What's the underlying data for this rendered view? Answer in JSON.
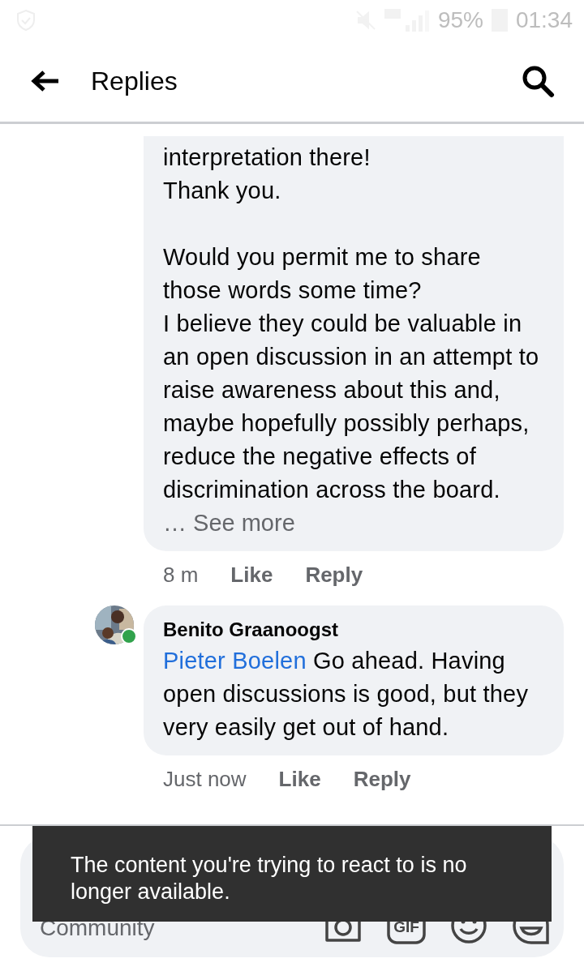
{
  "status_bar": {
    "battery": "95%",
    "time": "01:34"
  },
  "header": {
    "title": "Replies"
  },
  "comments": [
    {
      "text": "interpretation there!\nThank you.\n\nWould you permit me to share those words some time?\nI believe they could be valuable in an open discussion in an attempt to raise awareness about this and, maybe hopefully possibly perhaps, reduce the negative effects of discrimination across the board.",
      "see_more": "… See more",
      "time": "8 m",
      "like": "Like",
      "reply": "Reply",
      "kind": "cut"
    },
    {
      "author": "Benito Graanoogst",
      "mention": "Pieter Boelen",
      "text": "Go ahead. Having open discussions is good, but they very easily get out of hand.",
      "time": "Just now",
      "like": "Like",
      "reply": "Reply",
      "online": true,
      "kind": "reply"
    }
  ],
  "composer": {
    "placeholder": "Community",
    "gif_label": "GIF"
  },
  "toast": {
    "message": "The content you're trying to react to is no longer available."
  }
}
